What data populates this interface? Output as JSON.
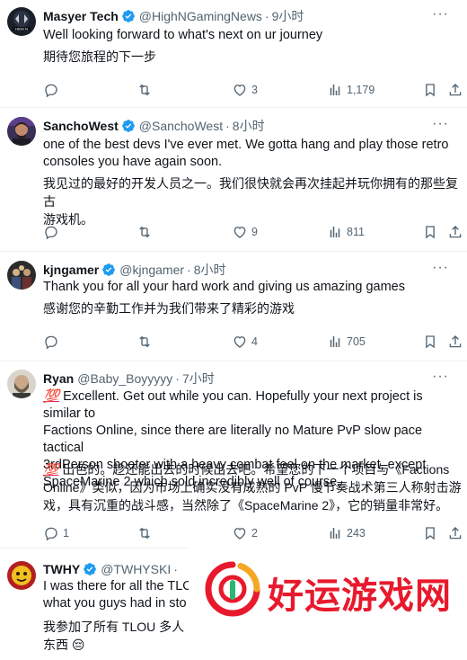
{
  "tweets": [
    {
      "name": "Masyer Tech",
      "verified": true,
      "handle": "@HighNGamingNews",
      "time": "9小时",
      "text": "Well looking forward to what's next on ur journey",
      "translation": "期待您旅程的下一步",
      "replies": "",
      "retweets": "",
      "likes": "3",
      "views": "1,179"
    },
    {
      "name": "SanchoWest",
      "verified": true,
      "handle": "@SanchoWest",
      "time": "8小时",
      "text": "one of the best devs I've ever met. We gotta hang and play those retro\nconsoles you have again soon.",
      "translation": "我见过的最好的开发人员之一。我们很快就会再次挂起并玩你拥有的那些复古\n游戏机。",
      "replies": "",
      "retweets": "",
      "likes": "9",
      "views": "811"
    },
    {
      "name": "kjngamer",
      "verified": true,
      "handle": "@kjngamer",
      "time": "8小时",
      "text": "Thank you for all your hard work and giving us amazing games",
      "translation": "感谢您的辛勤工作并为我们带来了精彩的游戏",
      "replies": "",
      "retweets": "",
      "likes": "4",
      "views": "705"
    },
    {
      "name": "Ryan",
      "verified": false,
      "handle": "@Baby_Boyyyyy",
      "time": "7小时",
      "emoji": "💯",
      "text": " Excellent. Get out while you can. Hopefully your next project is similar to\nFactions Online, since there are literally no Mature PvP slow pace tactical\n3rdPerson shooter with a heavy combat feel on the market, except\nSpaceMarine 2 which sold incredibly well of course.",
      "translation_emoji": "💯",
      "translation": " 出色的。趁还能出去的时候出去吧。希望您的下一个项目与《Factions\nOnline》类似，因为市场上确实没有成熟的 PvP 慢节奏战术第三人称射击游\n戏，具有沉重的战斗感，当然除了《SpaceMarine 2》，它的销量非常好。",
      "replies": "1",
      "retweets": "",
      "likes": "2",
      "views": "243"
    },
    {
      "name": "TWHY",
      "verified": true,
      "handle": "@TWHYSKI",
      "time": "",
      "text": "I was there for all the TLO\nwhat you guys had in sto",
      "translation": "我参加了所有 TLOU 多人\n东西 😔",
      "replies": "",
      "retweets": "",
      "likes": "",
      "views": ""
    }
  ],
  "watermark": {
    "text": "好运游戏网"
  },
  "colors": {
    "text": "#0f1419",
    "secondary": "#536471",
    "verified": "#1d9bf0",
    "divider": "#eff3f4",
    "watermark": "#e8192c"
  },
  "icons": [
    "reply-icon",
    "retweet-icon",
    "like-icon",
    "views-icon",
    "bookmark-icon",
    "share-icon",
    "verified-badge-icon",
    "more-icon"
  ]
}
